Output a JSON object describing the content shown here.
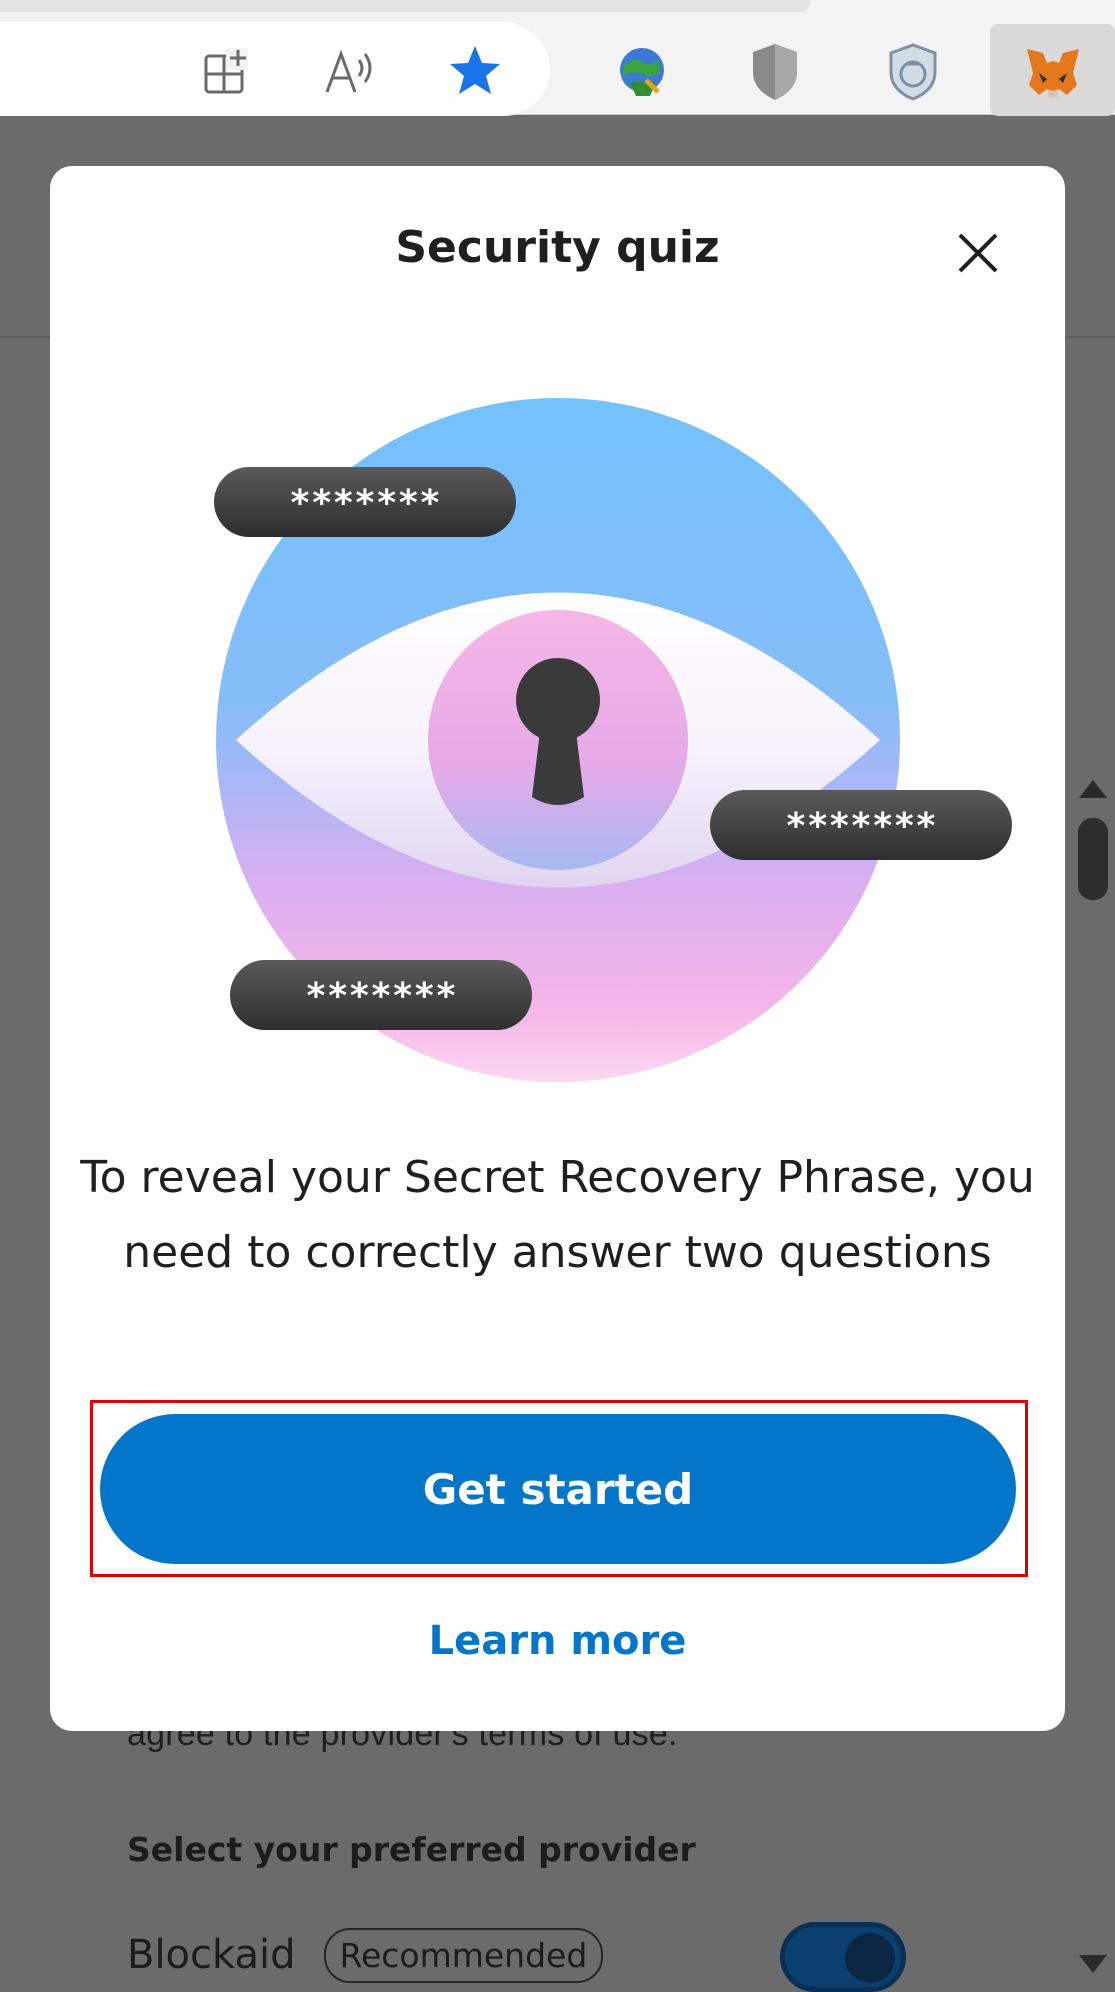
{
  "toolbar": {
    "icons": [
      "split-screen-icon",
      "read-aloud-icon",
      "favorite-star-icon",
      "globe-extension-icon",
      "shield-extension-icon",
      "privacy-badge-icon",
      "metamask-fox-icon"
    ],
    "star_color": "#1a73e8"
  },
  "modal": {
    "title": "Security quiz",
    "masked_labels": [
      "*******",
      "*******",
      "*******"
    ],
    "message": "To reveal your Secret Recovery Phrase, you need to correctly answer two questions",
    "primary_button": "Get started",
    "secondary_link": "Learn more"
  },
  "background": {
    "terms_text": "agree to the provider's terms of use.",
    "select_label": "Select your preferred provider",
    "provider_name": "Blockaid",
    "provider_badge": "Recommended"
  },
  "colors": {
    "accent": "#0376c9",
    "overlay": "#6b6b6b",
    "highlight": "#e00000"
  }
}
